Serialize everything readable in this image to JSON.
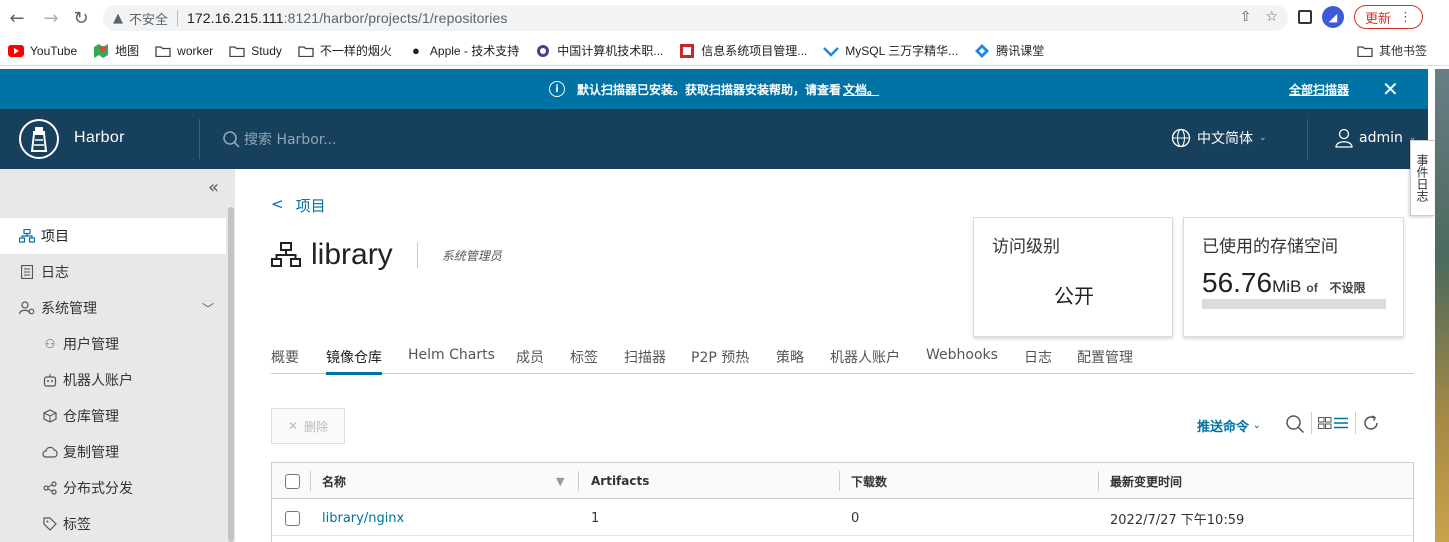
{
  "browser": {
    "insecure_label": "不安全",
    "url_host": "172.16.215.111",
    "url_rest": ":8121/harbor/projects/1/repositories",
    "update_label": "更新",
    "bookmarks": [
      {
        "label": "YouTube",
        "icon": "youtube-icon"
      },
      {
        "label": "地图",
        "icon": "maps-icon"
      },
      {
        "label": "worker",
        "icon": "folder-icon"
      },
      {
        "label": "Study",
        "icon": "folder-icon"
      },
      {
        "label": "不一样的烟火",
        "icon": "folder-icon"
      },
      {
        "label": "Apple - 技术支持",
        "icon": "apple-icon"
      },
      {
        "label": "中国计算机技术职...",
        "icon": "site-icon"
      },
      {
        "label": "信息系统项目管理...",
        "icon": "site-icon"
      },
      {
        "label": "MySQL 三万字精华...",
        "icon": "site-icon"
      },
      {
        "label": "腾讯课堂",
        "icon": "site-icon"
      }
    ],
    "other_bookmarks": "其他书签"
  },
  "banner": {
    "message": "默认扫描器已安装。获取扫描器安装帮助，请查看",
    "doc_link": "文档。",
    "all_scanners": "全部扫描器"
  },
  "header": {
    "brand": "Harbor",
    "search_placeholder": "搜索 Harbor...",
    "language": "中文简体",
    "user": "admin",
    "event_log": "事件日志"
  },
  "sidebar": {
    "items": [
      {
        "label": "项目",
        "icon": "projects-icon",
        "active": true
      },
      {
        "label": "日志",
        "icon": "logs-icon"
      },
      {
        "label": "系统管理",
        "icon": "admin-icon"
      }
    ],
    "sub_items": [
      {
        "label": "用户管理",
        "icon": "users-icon"
      },
      {
        "label": "机器人账户",
        "icon": "robot-icon"
      },
      {
        "label": "仓库管理",
        "icon": "registry-icon"
      },
      {
        "label": "复制管理",
        "icon": "replication-icon"
      },
      {
        "label": "分布式分发",
        "icon": "distribution-icon"
      },
      {
        "label": "标签",
        "icon": "tag-icon"
      }
    ]
  },
  "main": {
    "back_label": "项目",
    "project_name": "library",
    "role": "系统管理员",
    "access_card": {
      "title": "访问级别",
      "value": "公开"
    },
    "storage_card": {
      "title": "已使用的存储空间",
      "amount": "56.76",
      "unit": "MiB",
      "of": "of",
      "limit": "不设限"
    },
    "tabs": [
      "概要",
      "镜像仓库",
      "Helm Charts",
      "成员",
      "标签",
      "扫描器",
      "P2P 预热",
      "策略",
      "机器人账户",
      "Webhooks",
      "日志",
      "配置管理"
    ],
    "active_tab": 1,
    "delete_label": "删除",
    "push_command": "推送命令",
    "table": {
      "columns": [
        "名称",
        "Artifacts",
        "下载数",
        "最新变更时间"
      ],
      "rows": [
        {
          "name": "library/nginx",
          "artifacts": "1",
          "pulls": "0",
          "updated": "2022/7/27 下午10:59"
        }
      ]
    }
  },
  "colors": {
    "banner": "#0072a3",
    "header": "#17405c",
    "accent": "#0072a3"
  }
}
